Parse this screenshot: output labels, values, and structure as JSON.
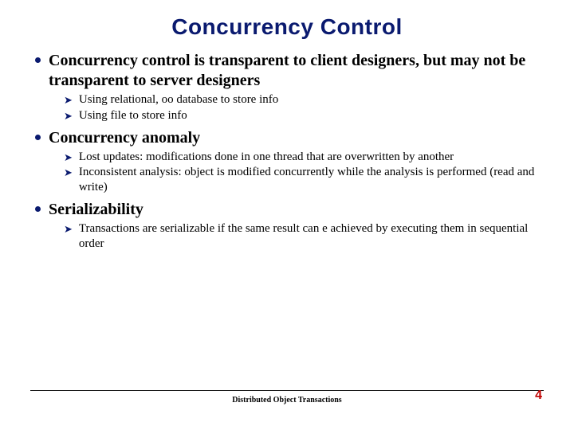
{
  "title": "Concurrency Control",
  "bullets": [
    {
      "text": "Concurrency control is transparent to client designers, but may not be transparent to server designers",
      "sub": [
        "Using relational, oo database to store info",
        "Using file to store info"
      ]
    },
    {
      "text": "Concurrency anomaly",
      "sub": [
        "Lost updates: modifications done in one thread that are overwritten by another",
        "Inconsistent analysis: object is modified concurrently while the analysis is performed (read and write)"
      ]
    },
    {
      "text": "Serializability",
      "sub": [
        "Transactions are serializable if the same result can e achieved by executing them in sequential order"
      ]
    }
  ],
  "footer": "Distributed Object Transactions",
  "page": "4"
}
